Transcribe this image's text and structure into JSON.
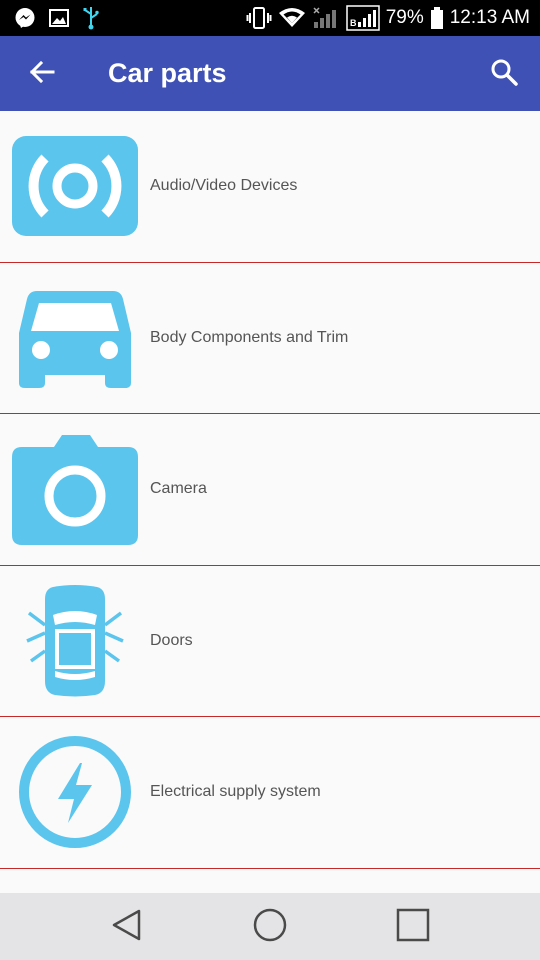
{
  "status": {
    "battery": "79%",
    "time": "12:13 AM",
    "left_icons": [
      "messenger-icon",
      "gallery-icon",
      "usb-icon"
    ],
    "right_icons": [
      "vibrate-icon",
      "wifi-icon",
      "signal-icon",
      "signal-icon-2",
      "battery-icon"
    ]
  },
  "app_bar": {
    "title": "Car parts",
    "color": "#3f51b5"
  },
  "list": {
    "accent": "#5bc5ed",
    "divider": "#c62828",
    "items": [
      {
        "label": "Audio/Video Devices",
        "icon": "audio-video-icon"
      },
      {
        "label": "Body Components and Trim",
        "icon": "car-body-icon"
      },
      {
        "label": "Camera",
        "icon": "camera-icon"
      },
      {
        "label": "Doors",
        "icon": "car-doors-icon"
      },
      {
        "label": "Electrical supply system",
        "icon": "electrical-bolt-icon"
      }
    ]
  },
  "nav": {
    "buttons": [
      "back-triangle-icon",
      "home-circle-icon",
      "recents-square-icon"
    ]
  }
}
